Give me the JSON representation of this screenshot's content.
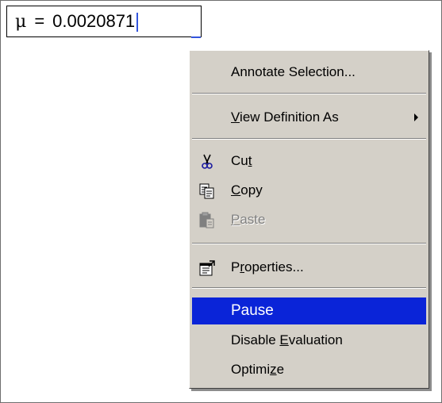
{
  "expression": {
    "symbol": "μ",
    "operator": "=",
    "value": "0.0020871"
  },
  "context_menu": {
    "items": [
      {
        "label": "Annotate Selection...",
        "enabled": true
      },
      {
        "label": "View Definition As",
        "enabled": true,
        "has_submenu": true
      },
      {
        "label": "Cut",
        "accelerator": "t",
        "icon": "scissors-icon",
        "enabled": true
      },
      {
        "label": "Copy",
        "accelerator": "C",
        "icon": "copy-icon",
        "enabled": true
      },
      {
        "label": "Paste",
        "accelerator": "P",
        "icon": "paste-icon",
        "enabled": false
      },
      {
        "label": "Properties...",
        "accelerator": "r",
        "icon": "properties-icon",
        "enabled": true
      },
      {
        "label": "Pause",
        "enabled": true,
        "highlighted": true
      },
      {
        "label": "Disable Evaluation",
        "accelerator": "E",
        "enabled": true
      },
      {
        "label": "Optimize",
        "accelerator": "z",
        "enabled": true
      }
    ]
  },
  "colors": {
    "menu_background": "#d4d0c8",
    "highlight": "#0a24d8",
    "caret": "#3355dd"
  }
}
